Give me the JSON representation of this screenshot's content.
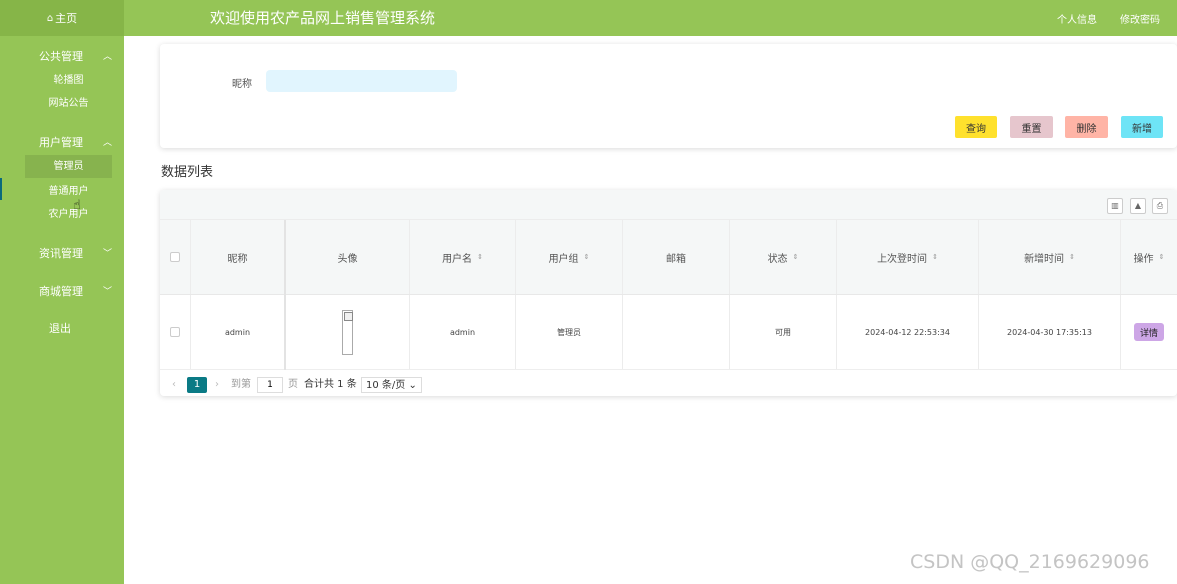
{
  "sidebar": {
    "home": "主页",
    "groups": [
      {
        "title": "公共管理",
        "chevron": "^",
        "items": [
          "轮播图",
          "网站公告"
        ]
      },
      {
        "title": "用户管理",
        "chevron": "^",
        "items": [
          "管理员",
          "普通用户",
          "农户用户"
        ]
      },
      {
        "title": "资讯管理",
        "chevron": "v"
      },
      {
        "title": "商城管理",
        "chevron": "v"
      },
      {
        "title": "退出"
      }
    ]
  },
  "header": {
    "title": "欢迎使用农产品网上销售管理系统",
    "profile": "个人信息",
    "password": "修改密码"
  },
  "search": {
    "label": "昵称",
    "value": ""
  },
  "buttons": {
    "query": "查询",
    "reset": "重置",
    "delete": "删除",
    "add": "新增"
  },
  "colors": {
    "sidebar": "#95c556",
    "query": "#ffe12d",
    "reset": "#e6c6cd",
    "delete": "#ffb4a6",
    "add": "#6ee4f6",
    "detail": "#cda6e6",
    "page_active": "#0a7a85"
  },
  "list_title": "数据列表",
  "table": {
    "headers": [
      "昵称",
      "头像",
      "用户名",
      "用户组",
      "邮箱",
      "状态",
      "上次登时间",
      "新增时间",
      "操作"
    ],
    "rows": [
      {
        "nickname": "admin",
        "username": "admin",
        "group": "管理员",
        "email": "",
        "status": "可用",
        "last_login": "2024-04-12 22:53:34",
        "created": "2024-04-30 17:35:13",
        "action": "详情"
      }
    ]
  },
  "pagination": {
    "current": "1",
    "goto_prefix": "到第",
    "goto_value": "1",
    "goto_suffix": "页",
    "total": "合计共 1 条",
    "page_size": "10 条/页"
  },
  "watermark": "CSDN @QQ_2169629096"
}
